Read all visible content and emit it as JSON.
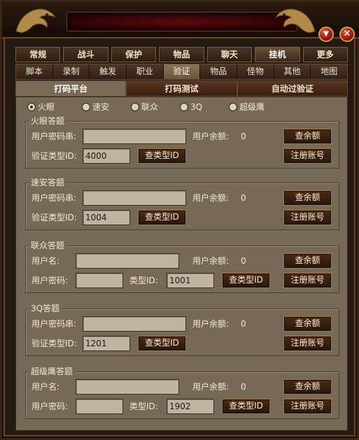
{
  "tabs_main": [
    "常规",
    "战斗",
    "保护",
    "物品",
    "聊天",
    "挂机",
    "更多"
  ],
  "tabs_main_active": 5,
  "tabs_sub": [
    "脚本",
    "录制",
    "触发",
    "职业",
    "验证",
    "物品",
    "怪物",
    "其他",
    "地图"
  ],
  "tabs_sub_active": 4,
  "tabs_third": [
    "打码平台",
    "打码测试",
    "自动过验证"
  ],
  "tabs_third_active": 0,
  "radios": [
    {
      "label": "火眼",
      "checked": true
    },
    {
      "label": "速安",
      "checked": false
    },
    {
      "label": "联众",
      "checked": false
    },
    {
      "label": "3Q",
      "checked": false
    },
    {
      "label": "超级鹰",
      "checked": false
    }
  ],
  "groups": {
    "huoyan": {
      "title": "火眼答题",
      "user_label": "用户密码串:",
      "balance_label": "用户余额:",
      "balance_value": "0",
      "type_label": "验证类型ID:",
      "type_value": "4000",
      "query_type_btn": "查类型ID",
      "query_balance_btn": "查余额",
      "register_btn": "注册账号"
    },
    "suan": {
      "title": "速安答题",
      "user_label": "用户密码串:",
      "balance_label": "用户余额:",
      "balance_value": "0",
      "type_label": "验证类型ID:",
      "type_value": "1004",
      "query_type_btn": "查类型ID",
      "query_balance_btn": "查余额",
      "register_btn": "注册账号"
    },
    "lianzhong": {
      "title": "联众答题",
      "user_label": "用户名:",
      "pass_label": "用户密码:",
      "balance_label": "用户余额:",
      "balance_value": "0",
      "type_label": "类型ID:",
      "type_value": "1001",
      "query_type_btn": "查类型ID",
      "query_balance_btn": "查余额",
      "register_btn": "注册账号"
    },
    "q3": {
      "title": "3Q答题",
      "user_label": "用户密码串:",
      "balance_label": "用户余额:",
      "balance_value": "0",
      "type_label": "验证类型ID:",
      "type_value": "1201",
      "query_type_btn": "查类型ID",
      "query_balance_btn": "查余额",
      "register_btn": "注册账号"
    },
    "chaojiying": {
      "title": "超级鹰答题",
      "user_label": "用户名:",
      "pass_label": "用户密码:",
      "balance_label": "用户余额:",
      "balance_value": "0",
      "type_label": "类型ID:",
      "type_value": "1902",
      "query_type_btn": "查类型ID",
      "query_balance_btn": "查余额",
      "register_btn": "注册账号"
    }
  },
  "colors": {
    "accent": "#a07a48",
    "panel": "#766a56",
    "title_plate": "#5a0a0c",
    "close_button": "#9a1610"
  },
  "icons": {
    "minimize": "chevron-down-icon",
    "close": "close-icon",
    "decor": "dragon-icon"
  }
}
